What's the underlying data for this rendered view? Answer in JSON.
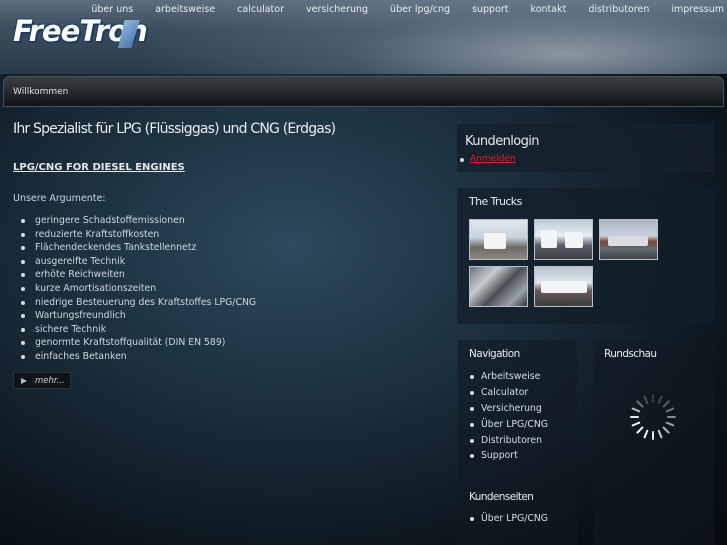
{
  "header": {
    "logo_text": "FreeTron",
    "nav": [
      "über uns",
      "arbeitsweise",
      "calculator",
      "versicherung",
      "über lpg/cng",
      "support",
      "kontakt",
      "distributoren",
      "impressum"
    ]
  },
  "breadcrumb_bar": {
    "label": "Willkommen"
  },
  "main": {
    "title": "Ihr Spezialist für LPG (Flüssiggas) und CNG (Erdgas)",
    "subtitle": "LPG/CNG FOR DIESEL ENGINES",
    "lead": "Unsere Argumente:",
    "arguments": [
      "geringere Schadstoffemissionen",
      "reduzierte Kraftstoffkosten",
      "Flächendeckendes Tankstellennetz",
      "ausgereifte Technik",
      "erhöte Reichweiten",
      "kurze Amortisationszeiten",
      "niedrige Besteuerung des Kraftstoffes LPG/CNG",
      "Wartungsfreundlich",
      "sichere Technik",
      "genormte Kraftstoffqualität (DIN EN 589)",
      "einfaches Betanken"
    ],
    "more_label": "mehr..."
  },
  "login": {
    "title": "Kundenlogin",
    "link": "Anmelden"
  },
  "trucks": {
    "title": "The Trucks"
  },
  "navigation": {
    "title": "Navigation",
    "items": [
      "Arbeitsweise",
      "Calculator",
      "Versicherung",
      "Über LPG/CNG",
      "Distributoren",
      "Support"
    ]
  },
  "kundenseiten": {
    "title": "Kundenseiten",
    "items": [
      "Über LPG/CNG"
    ]
  },
  "rundschau": {
    "title": "Rundschau"
  },
  "colors": {
    "link_red": "#e02020",
    "logo_outline": "#1a3c66"
  }
}
